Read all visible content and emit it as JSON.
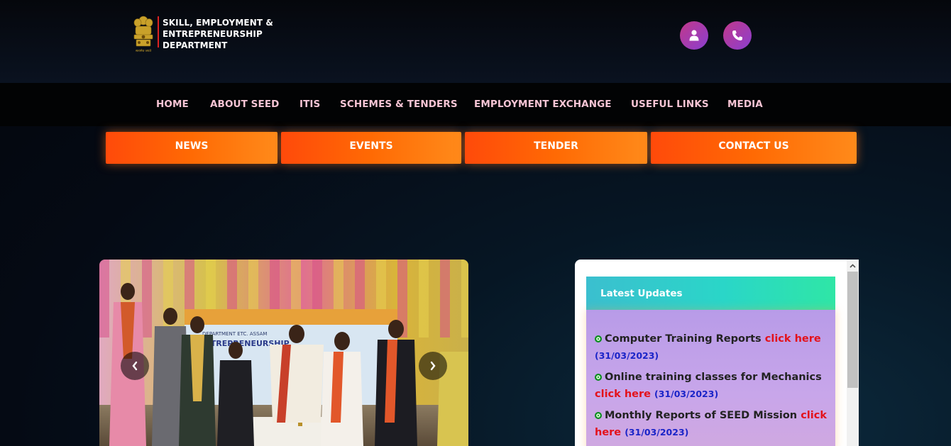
{
  "header": {
    "logo_lines": [
      "SKILL, EMPLOYMENT &",
      "ENTREPRENEURSHIP",
      "DEPARTMENT"
    ],
    "emblem_caption": "सत्यमेव जयते",
    "actions": [
      {
        "icon": "user-icon"
      },
      {
        "icon": "phone-icon"
      }
    ]
  },
  "nav": {
    "items": [
      "HOME",
      "ABOUT SEED",
      "ITIS",
      "SCHEMES & TENDERS",
      "EMPLOYMENT EXCHANGE",
      "USEFUL LINKS",
      "MEDIA"
    ]
  },
  "quick_links": [
    "NEWS",
    "EVENTS",
    "TENDER",
    "CONTACT US"
  ],
  "carousel": {
    "banner_text": "ENTREPRENEURSHIP",
    "banner_subtext": "DEPARTMENT ETC. ASSAM",
    "prev_icon": "chevron-left-icon",
    "next_icon": "chevron-right-icon"
  },
  "updates": {
    "title": "Latest Updates",
    "items": [
      {
        "text": "Computer Training Reports",
        "link": "click here",
        "date": "(31/03/2023)"
      },
      {
        "text": "Online training classes for Mechanics",
        "link": "click here",
        "date": "(31/03/2023)"
      },
      {
        "text": "Monthly Reports of SEED Mission",
        "link": "click here",
        "date": "(31/03/2023)"
      }
    ]
  },
  "colors": {
    "accent_orange": "#ff6a04",
    "nav_text": "#f6c4d4",
    "link_red": "#e3121b",
    "date_blue": "#1a24c8"
  }
}
